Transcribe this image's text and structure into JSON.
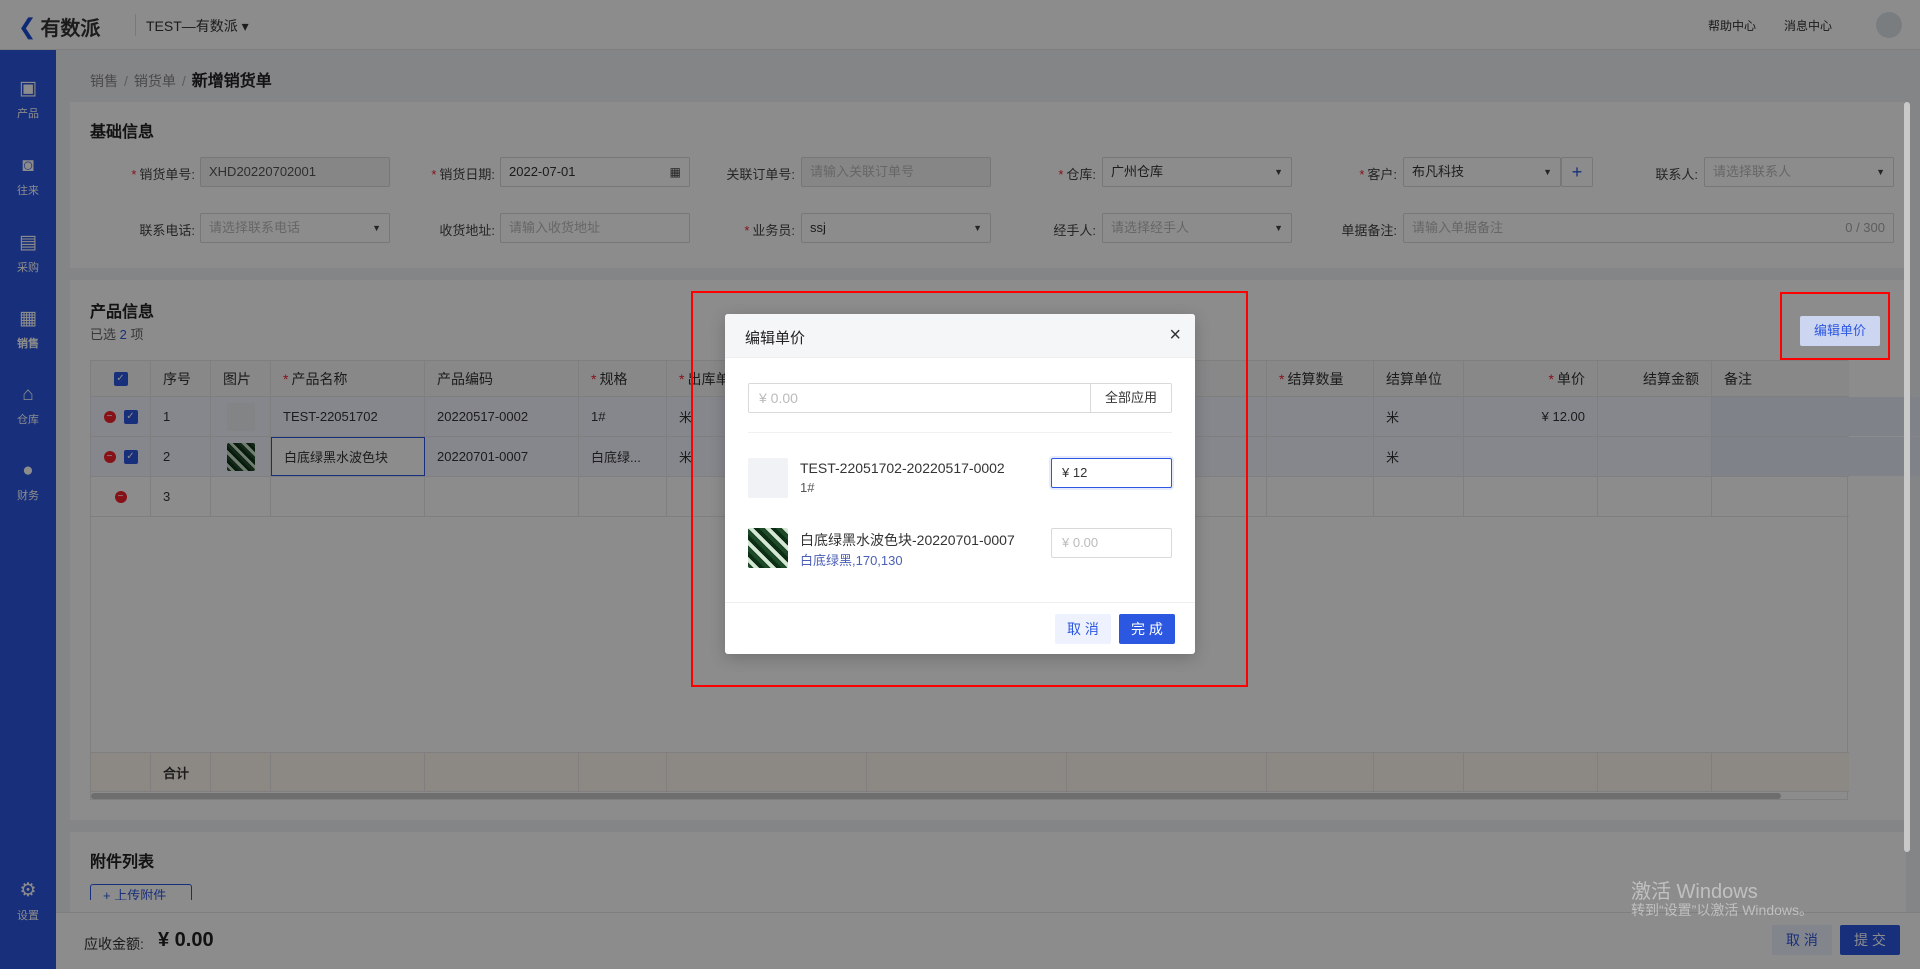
{
  "topbar": {
    "logo": "有数派",
    "org": "TEST—有数派",
    "help": "帮助中心",
    "messages": "消息中心"
  },
  "sidebar": {
    "items": [
      {
        "label": "产品",
        "icon": "box-icon"
      },
      {
        "label": "往来",
        "icon": "contact-icon"
      },
      {
        "label": "采购",
        "icon": "cart-icon"
      },
      {
        "label": "销售",
        "icon": "clipboard-icon"
      },
      {
        "label": "仓库",
        "icon": "warehouse-icon"
      },
      {
        "label": "财务",
        "icon": "money-bag-icon"
      }
    ],
    "settings": "设置"
  },
  "breadcrumb": {
    "l1": "销售",
    "l2": "销货单",
    "current": "新增销货单"
  },
  "basic": {
    "title": "基础信息",
    "order_no": {
      "label": "销货单号:",
      "value": "XHD20220702001"
    },
    "date": {
      "label": "销货日期:",
      "value": "2022-07-01"
    },
    "related": {
      "label": "关联订单号:",
      "placeholder": "请输入关联订单号"
    },
    "warehouse": {
      "label": "仓库:",
      "value": "广州仓库"
    },
    "customer": {
      "label": "客户:",
      "value": "布凡科技"
    },
    "contact": {
      "label": "联系人:",
      "placeholder": "请选择联系人"
    },
    "phone": {
      "label": "联系电话:",
      "placeholder": "请选择联系电话"
    },
    "address": {
      "label": "收货地址:",
      "placeholder": "请输入收货地址"
    },
    "salesman": {
      "label": "业务员:",
      "value": "ssj"
    },
    "handler": {
      "label": "经手人:",
      "placeholder": "请选择经手人"
    },
    "remark": {
      "label": "单据备注:",
      "placeholder": "请输入单据备注",
      "count": "0 / 300"
    }
  },
  "products": {
    "title": "产品信息",
    "selected_prefix": "已选",
    "selected_count": "2",
    "selected_suffix": "项",
    "edit_price_btn": "编辑单价",
    "headers": {
      "seq": "序号",
      "img": "图片",
      "name": "产品名称",
      "code": "产品编码",
      "spec": "规格",
      "out_unit": "出库单",
      "settle_qty": "结算数量",
      "settle_unit": "结算单位",
      "price": "单价",
      "amount": "结算金额",
      "note": "备注"
    },
    "rows": [
      {
        "seq": "1",
        "name": "TEST-22051702",
        "code": "20220517-0002",
        "spec": "1#",
        "unit": "米",
        "settle_unit": "米",
        "price": "¥ 12.00"
      },
      {
        "seq": "2",
        "name": "白底绿黑水波色块",
        "code": "20220701-0007",
        "spec": "白底绿...",
        "unit": "米",
        "settle_unit": "米",
        "price": ""
      },
      {
        "seq": "3"
      }
    ],
    "total_label": "合计"
  },
  "attachments": {
    "title": "附件列表",
    "upload": "上传附件"
  },
  "footer": {
    "receivable_label": "应收金额:",
    "receivable_value": "¥ 0.00",
    "cancel": "取 消",
    "submit": "提 交"
  },
  "dialog": {
    "title": "编辑单价",
    "close": "×",
    "batch_placeholder": "¥ 0.00",
    "apply_all": "全部应用",
    "items": [
      {
        "name": "TEST-22051702-20220517-0002",
        "spec": "1#",
        "price": "¥ 12"
      },
      {
        "name": "白底绿黑水波色块-20220701-0007",
        "spec": "白底绿黑,170,130",
        "price_placeholder": "¥ 0.00"
      }
    ],
    "cancel": "取 消",
    "confirm": "完 成"
  },
  "watermark": {
    "line1": "激活 Windows",
    "line2": "转到“设置”以激活 Windows。"
  },
  "colors": {
    "primary": "#2c57e0",
    "required": "#f5222d",
    "highlight": "#ff0000"
  }
}
